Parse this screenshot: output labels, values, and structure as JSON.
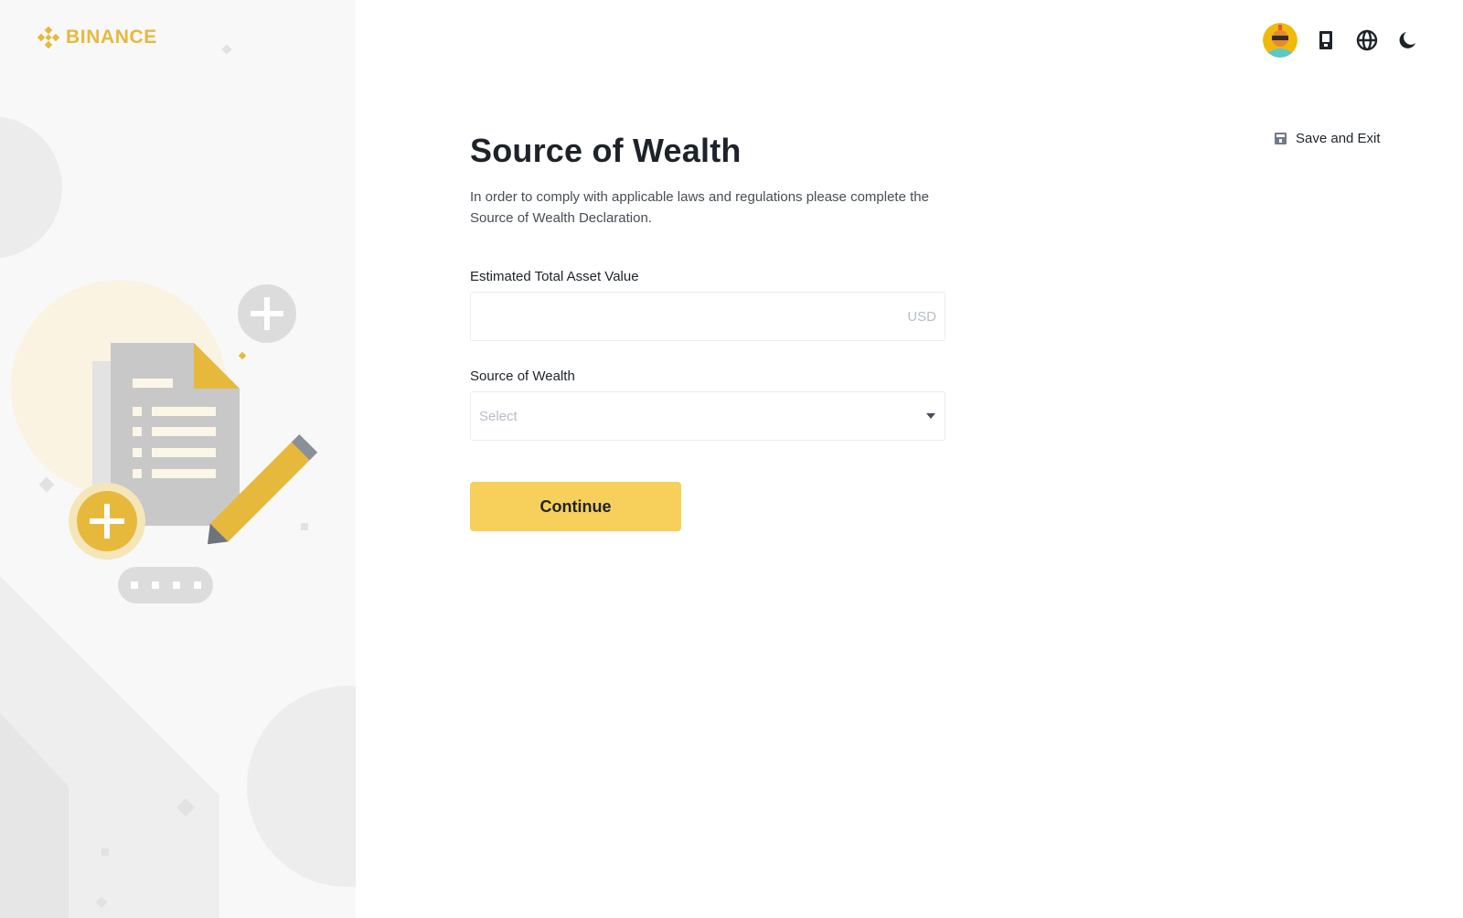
{
  "brand": {
    "name": "BINANCE",
    "color": "#e6b93d"
  },
  "header": {
    "icons": [
      "avatar",
      "mobile-download-icon",
      "globe-icon",
      "moon-icon"
    ]
  },
  "save_exit": {
    "label": "Save and Exit",
    "icon": "save-icon"
  },
  "form": {
    "title": "Source of Wealth",
    "description": "In order to comply with applicable laws and regulations please complete the Source of Wealth Declaration.",
    "asset_field": {
      "label": "Estimated Total Asset Value",
      "value": "",
      "suffix": "USD"
    },
    "wealth_field": {
      "label": "Source of Wealth",
      "placeholder": "Select",
      "icon": "caret-down-icon"
    },
    "continue_label": "Continue"
  },
  "colors": {
    "accent": "#f7d05b",
    "text": "#1e2329",
    "muted": "#b7bdc6",
    "panel": "#f8f8f8"
  }
}
